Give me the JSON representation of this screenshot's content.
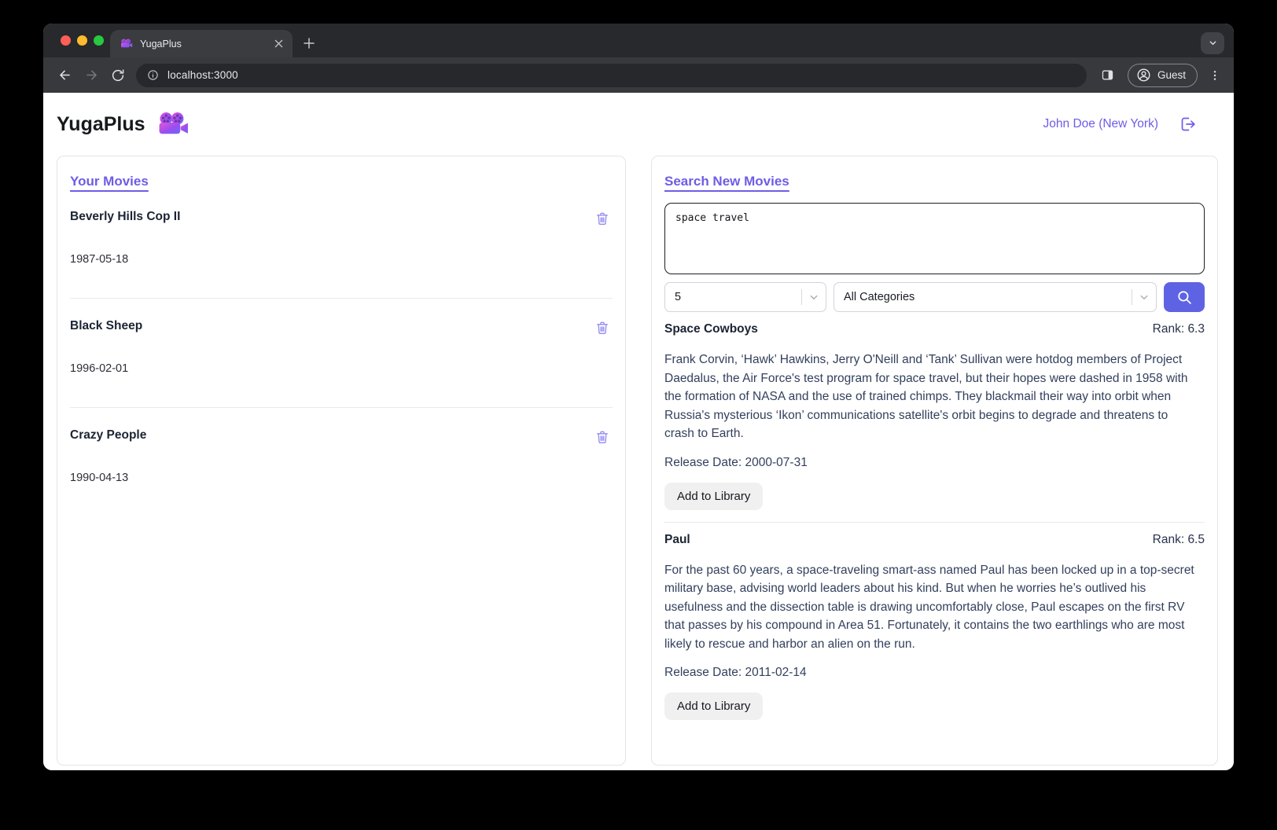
{
  "browser": {
    "tab": {
      "title": "YugaPlus",
      "favicon": "movie-camera-icon"
    },
    "url": "localhost:3000",
    "guest_label": "Guest"
  },
  "header": {
    "app_title": "YugaPlus",
    "logo": "movie-camera-icon",
    "user_link": "John Doe (New York)"
  },
  "library": {
    "heading": "Your Movies",
    "movies": [
      {
        "title": "Beverly Hills Cop II",
        "release_date": "1987-05-18"
      },
      {
        "title": "Black Sheep",
        "release_date": "1996-02-01"
      },
      {
        "title": "Crazy People",
        "release_date": "1990-04-13"
      }
    ]
  },
  "search": {
    "heading": "Search New Movies",
    "query": "space travel",
    "results_limit": "5",
    "category": "All Categories",
    "results": [
      {
        "title": "Space Cowboys",
        "rank_label": "Rank: 6.3",
        "description": "Frank Corvin, ‘Hawk’ Hawkins, Jerry O'Neill and ‘Tank’ Sullivan were hotdog members of Project Daedalus, the Air Force's test program for space travel, but their hopes were dashed in 1958 with the formation of NASA and the use of trained chimps. They blackmail their way into orbit when Russia's mysterious ‘Ikon’ communications satellite's orbit begins to degrade and threatens to crash to Earth.",
        "release_label": "Release Date: 2000-07-31",
        "add_label": "Add to Library"
      },
      {
        "title": "Paul",
        "rank_label": "Rank: 6.5",
        "description": "For the past 60 years, a space-traveling smart-ass named Paul has been locked up in a top-secret military base, advising world leaders about his kind. But when he worries he’s outlived his usefulness and the dissection table is drawing uncomfortably close, Paul escapes on the first RV that passes by his compound in Area 51. Fortunately, it contains the two earthlings who are most likely to rescue and harbor an alien on the run.",
        "release_label": "Release Date: 2011-02-14",
        "add_label": "Add to Library"
      }
    ]
  },
  "colors": {
    "accent_purple": "#6e5ce6",
    "search_button_indigo": "#5e63e4",
    "trash_icon_purple": "#948cf1",
    "logo_gradient": [
      "#e455d8",
      "#7b52f0"
    ]
  }
}
